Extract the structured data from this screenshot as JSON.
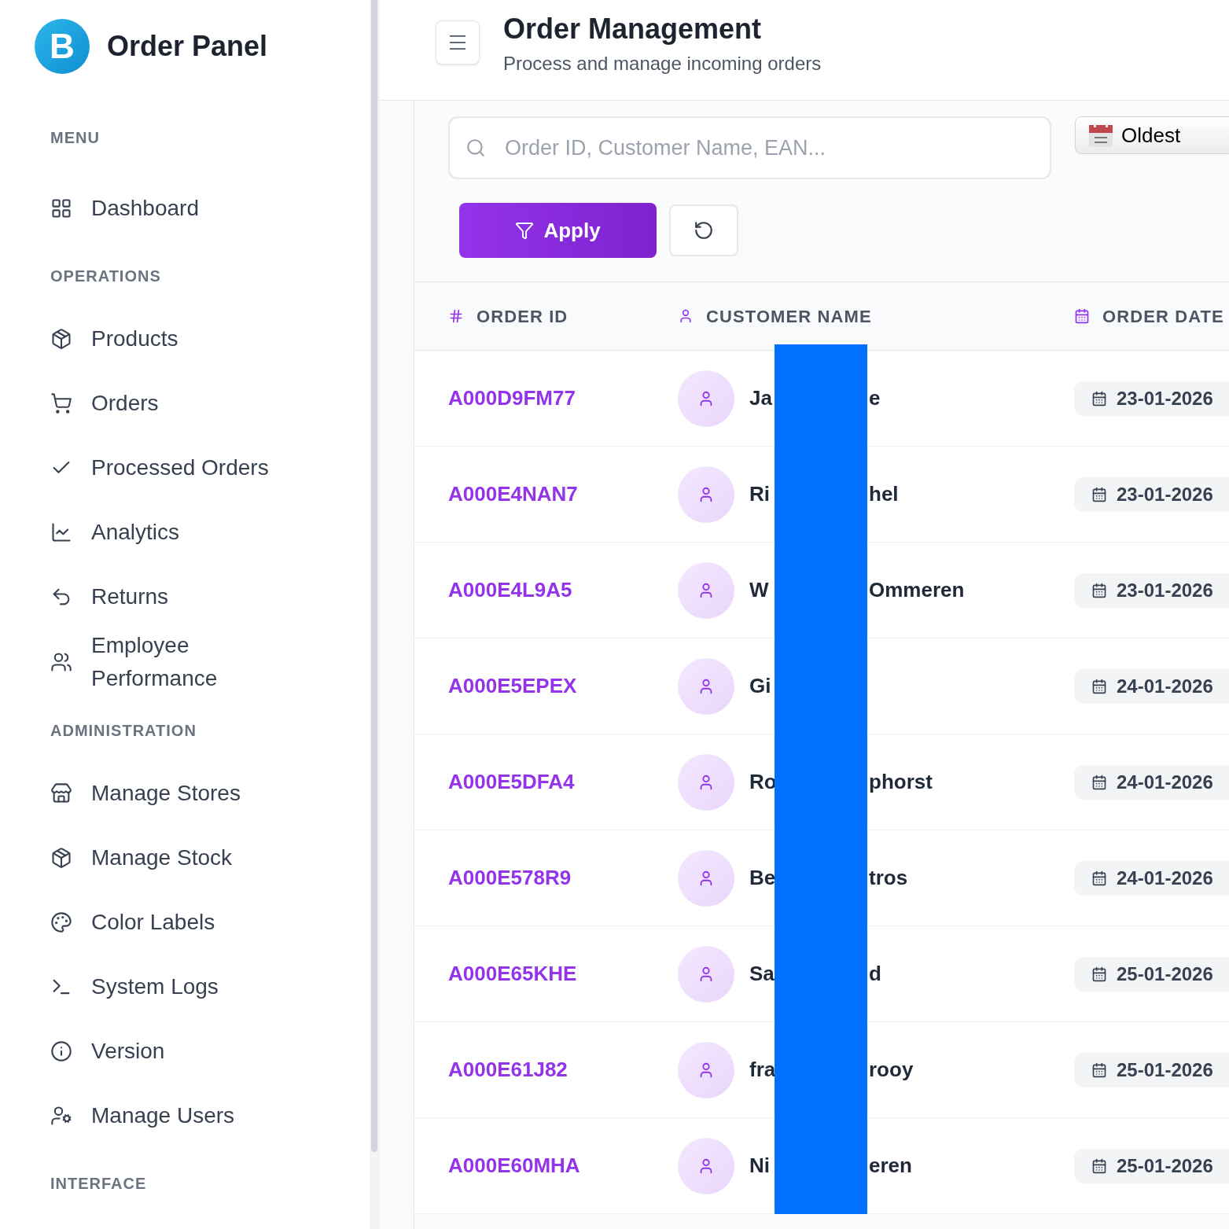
{
  "brand": {
    "logo_letter": "B",
    "name": "Order Panel"
  },
  "sidebar": {
    "sections": [
      {
        "title": "MENU",
        "items": [
          {
            "label": "Dashboard"
          }
        ]
      },
      {
        "title": "OPERATIONS",
        "items": [
          {
            "label": "Products"
          },
          {
            "label": "Orders"
          },
          {
            "label": "Processed Orders"
          },
          {
            "label": "Analytics"
          },
          {
            "label": "Returns"
          },
          {
            "label": "Employee Performance"
          }
        ]
      },
      {
        "title": "ADMINISTRATION",
        "items": [
          {
            "label": "Manage Stores"
          },
          {
            "label": "Manage Stock"
          },
          {
            "label": "Color Labels"
          },
          {
            "label": "System Logs"
          },
          {
            "label": "Version"
          },
          {
            "label": "Manage Users"
          }
        ]
      },
      {
        "title": "INTERFACE"
      }
    ]
  },
  "header": {
    "title": "Order Management",
    "subtitle": "Process and manage incoming orders"
  },
  "filters": {
    "search": {
      "placeholder": "Order ID, Customer Name, EAN..."
    },
    "sort": {
      "value": "Oldest"
    },
    "apply_label": "Apply"
  },
  "table": {
    "columns": [
      {
        "label": "ORDER ID"
      },
      {
        "label": "CUSTOMER NAME"
      },
      {
        "label": "ORDER DATE"
      }
    ],
    "rows": [
      {
        "order_id": "A000D9FM77",
        "name_start": "Ja",
        "name_end": "e",
        "date": "23-01-2026"
      },
      {
        "order_id": "A000E4NAN7",
        "name_start": "Ri",
        "name_end": "hel",
        "date": "23-01-2026"
      },
      {
        "order_id": "A000E4L9A5",
        "name_start": "W",
        "name_end": "Ommeren",
        "date": "23-01-2026"
      },
      {
        "order_id": "A000E5EPEX",
        "name_start": "Gi",
        "date": "24-01-2026"
      },
      {
        "order_id": "A000E5DFA4",
        "name_start": "Ro",
        "name_end": "phorst",
        "date": "24-01-2026"
      },
      {
        "order_id": "A000E578R9",
        "name_start": "Be",
        "name_end": "tros",
        "date": "24-01-2026"
      },
      {
        "order_id": "A000E65KHE",
        "name_start": "Sa",
        "name_end": "d",
        "date": "25-01-2026"
      },
      {
        "order_id": "A000E61J82",
        "name_start": "fra",
        "name_end": "rooy",
        "date": "25-01-2026"
      },
      {
        "order_id": "A000E60MHA",
        "name_start": "Ni",
        "name_end": "eren",
        "date": "25-01-2026"
      }
    ]
  }
}
